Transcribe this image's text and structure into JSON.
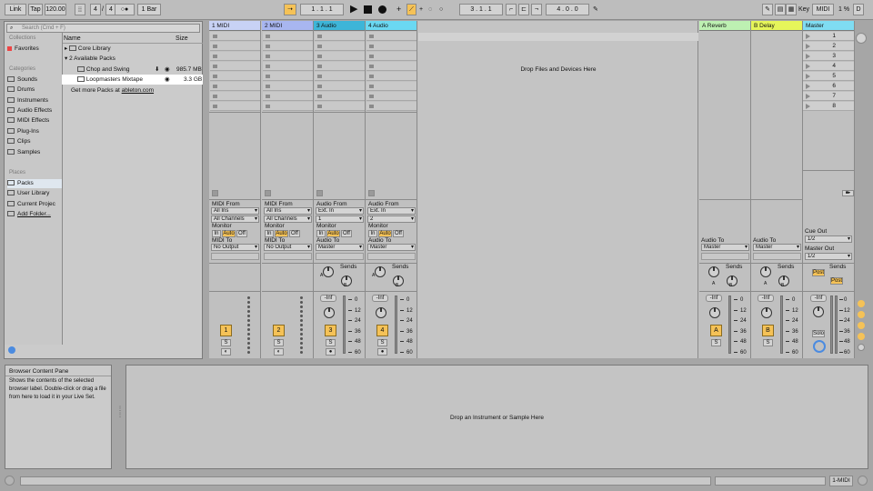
{
  "toolbar": {
    "link": "Link",
    "tap": "Tap",
    "tempo": "120.00",
    "signature_num": "4",
    "signature_den": "4",
    "metronome": "○●",
    "quantize": "1 Bar",
    "position": "1 .   1 .   1",
    "loop_start": "3 .   1 .   1",
    "loop_length": "4 .   0 .   0",
    "key": "Key",
    "midi": "MIDI",
    "cpu": "1 %",
    "d": "D"
  },
  "browser": {
    "search_placeholder": "Search (Cmd + F)",
    "collections_header": "Collections",
    "favorites": "Favorites",
    "categories_header": "Categories",
    "categories": [
      "Sounds",
      "Drums",
      "Instruments",
      "Audio Effects",
      "MIDI Effects",
      "Plug-Ins",
      "Clips",
      "Samples"
    ],
    "places_header": "Places",
    "places": [
      "Packs",
      "User Library",
      "Current Projec",
      "Add Folder..."
    ],
    "col_name": "Name",
    "col_size": "Size",
    "files": [
      {
        "name": "Core Library",
        "size": ""
      },
      {
        "name": "2 Available Packs",
        "size": ""
      },
      {
        "name": "Chop and Swing",
        "size": "985.7 MB"
      },
      {
        "name": "Loopmasters Mixtape",
        "size": "3.3 GB"
      }
    ],
    "more_packs_prefix": "Get more Packs at ",
    "more_packs_link": "ableton.com"
  },
  "tracks": [
    {
      "name": "1 MIDI",
      "color": "#c8d2f5",
      "from_label": "MIDI From",
      "from": "All Ins",
      "channel": "All Channels",
      "to_label": "MIDI To",
      "to": "No Output",
      "num": "1"
    },
    {
      "name": "2 MIDI",
      "color": "#a8b6f0",
      "from_label": "MIDI From",
      "from": "All Ins",
      "channel": "All Channels",
      "to_label": "MIDI To",
      "to": "No Output",
      "num": "2"
    },
    {
      "name": "3 Audio",
      "color": "#3db5d8",
      "from_label": "Audio From",
      "from": "Ext. In",
      "channel": "1",
      "to_label": "Audio To",
      "to": "Master",
      "num": "3"
    },
    {
      "name": "4 Audio",
      "color": "#6ad8f2",
      "from_label": "Audio From",
      "from": "Ext. In",
      "channel": "2",
      "to_label": "Audio To",
      "to": "Master",
      "num": "4"
    }
  ],
  "monitor": {
    "label": "Monitor",
    "in": "In",
    "auto": "Auto",
    "off": "Off"
  },
  "drop_files": "Drop Files and Devices Here",
  "returns": [
    {
      "name": "A Reverb",
      "color": "#bdf0b2",
      "to_label": "Audio To",
      "to": "Master",
      "letter": "A"
    },
    {
      "name": "B Delay",
      "color": "#e6f55a",
      "to_label": "Audio To",
      "to": "Master",
      "letter": "B"
    }
  ],
  "master": {
    "name": "Master",
    "color": "#7fdcf2",
    "cue_label": "Cue Out",
    "cue": "1/2",
    "master_out_label": "Master Out",
    "master_out": "1/2",
    "post": "Post",
    "solo": "Solo",
    "scenes": [
      "1",
      "2",
      "3",
      "4",
      "5",
      "6",
      "7",
      "8"
    ]
  },
  "sends": {
    "label": "Sends",
    "a": "A",
    "b": "B"
  },
  "mixer": {
    "vol": "-Inf",
    "s": "S",
    "scale": [
      "0",
      "12",
      "24",
      "36",
      "48",
      "60"
    ]
  },
  "info": {
    "title": "Browser Content Pane",
    "body": "Shows the contents of the selected browser label. Double-click or drag a file from here to load it in your Live Set."
  },
  "drop_instrument": "Drop an Instrument or Sample Here",
  "status_track": "1-MIDI"
}
